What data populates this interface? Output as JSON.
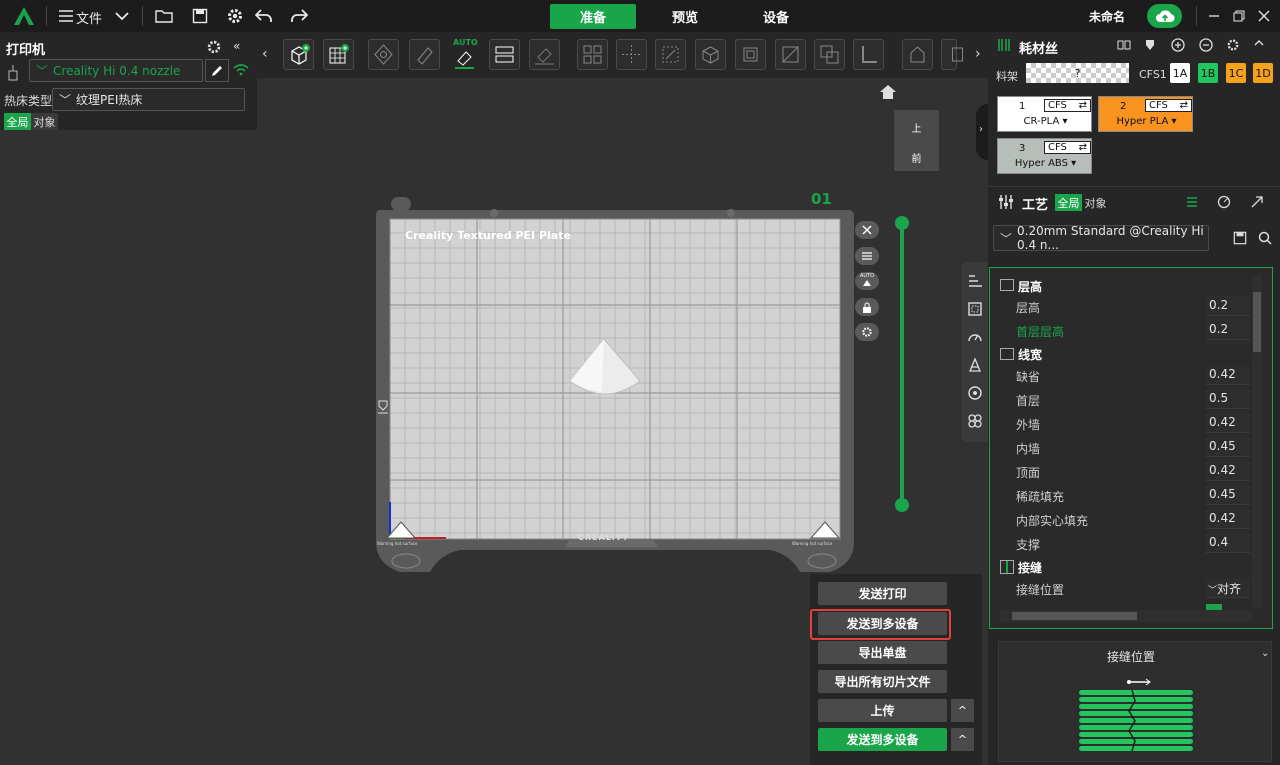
{
  "topbar": {
    "file_menu": "文件",
    "tabs": [
      "准备",
      "预览",
      "设备"
    ],
    "active_tab": 0,
    "project_name": "未命名"
  },
  "printer_panel": {
    "title": "打印机",
    "printer_select": "Creality Hi 0.4 nozzle",
    "bed_label": "热床类型",
    "bed_select": "纹理PEI热床",
    "scope_global": "全局",
    "scope_object": "对象"
  },
  "toolbar": {
    "auto_label": "AUTO"
  },
  "viewport": {
    "view_top": "上",
    "view_front": "前",
    "plate_number": "01",
    "plate_name": "Creality Textured PEI Plate",
    "plate_brand": "CREALITY",
    "plate_warning": "Warning hot surface",
    "plate_auto": "AUTO"
  },
  "filament": {
    "title": "耗材丝",
    "rack_label": "料架",
    "rack_unknown": "?",
    "cfs_label": "CFS1",
    "slots_small": [
      {
        "label": "1A",
        "color": "#ffffff"
      },
      {
        "label": "1B",
        "color": "#22c55e"
      },
      {
        "label": "1C",
        "color": "#f7a21b"
      },
      {
        "label": "1D",
        "color": "#f7a21b"
      }
    ],
    "slots": [
      {
        "num": "1",
        "tag": "CFS",
        "name": "CR-PLA",
        "color": "#ffffff"
      },
      {
        "num": "2",
        "tag": "CFS",
        "name": "Hyper PLA",
        "color": "#f7931e"
      },
      {
        "num": "3",
        "tag": "CFS",
        "name": "Hyper ABS",
        "color": "#b7bdb8"
      }
    ]
  },
  "process": {
    "title": "工艺",
    "scope_global": "全局",
    "scope_object": "对象",
    "profile": "0.20mm Standard @Creality Hi 0.4 n...",
    "groups": [
      {
        "title": "层高",
        "rows": [
          {
            "label": "层高",
            "value": "0.2"
          },
          {
            "label": "首层层高",
            "value": "0.2",
            "highlight": true
          }
        ]
      },
      {
        "title": "线宽",
        "rows": [
          {
            "label": "缺省",
            "value": "0.42"
          },
          {
            "label": "首层",
            "value": "0.5"
          },
          {
            "label": "外墙",
            "value": "0.42"
          },
          {
            "label": "内墙",
            "value": "0.45"
          },
          {
            "label": "顶面",
            "value": "0.42"
          },
          {
            "label": "稀疏填充",
            "value": "0.45"
          },
          {
            "label": "内部实心填充",
            "value": "0.42"
          },
          {
            "label": "支撑",
            "value": "0.4"
          }
        ]
      },
      {
        "title": "接缝",
        "rows": [
          {
            "label": "接缝位置",
            "value": "对齐"
          }
        ]
      }
    ]
  },
  "seam_preview": {
    "title": "接缝位置"
  },
  "actions": {
    "send_print": "发送打印",
    "send_multi": "发送到多设备",
    "export_plate": "导出单盘",
    "export_all": "导出所有切片文件",
    "upload": "上传",
    "send_multi_primary": "发送到多设备",
    "caret": "^"
  },
  "colors": {
    "accent": "#1aa54a",
    "highlight_border": "#e0413a"
  }
}
